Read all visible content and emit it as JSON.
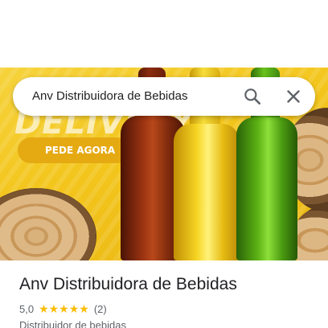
{
  "search": {
    "query": "Anv Distribuidora de Bebidas"
  },
  "hero": {
    "banner_text": "DELIVERY",
    "cta_label": "PEDE AGORA"
  },
  "place": {
    "name": "Anv Distribuidora de Bebidas",
    "rating": "5,0",
    "stars": "★★★★★",
    "star_count": 5,
    "review_count": "(2)",
    "category": "Distribuidor de bebidas"
  },
  "colors": {
    "star": "#fbbc04",
    "banner_yellow": "#f3c51c",
    "text_primary": "#202124",
    "text_secondary": "#5f6368"
  },
  "icons": {
    "search": "search-icon",
    "close": "close-icon"
  }
}
